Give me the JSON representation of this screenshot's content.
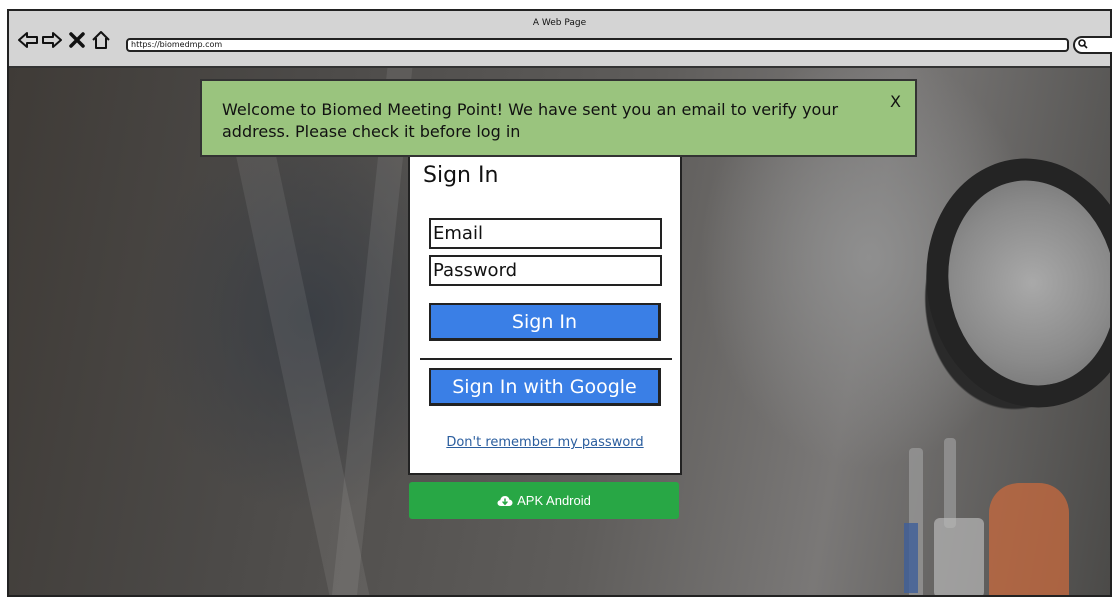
{
  "browser": {
    "page_title": "A Web Page",
    "url": "https://biomedmp.com",
    "nav": {
      "back_icon": "back-arrow-icon",
      "forward_icon": "forward-arrow-icon",
      "stop_icon": "close-icon",
      "home_icon": "home-icon",
      "search_icon": "search-icon"
    }
  },
  "notification": {
    "message": "Welcome to Biomed Meeting Point! We have sent you an email to verify your address. Please check it before log in",
    "close_label": "X",
    "color": "#9ac47e"
  },
  "signin": {
    "title": "Sign In",
    "email_placeholder": "Email",
    "password_placeholder": "Password",
    "submit_label": "Sign In",
    "google_label": "Sign In with Google",
    "forgot_label": "Don't remember my password",
    "button_color": "#3a7fe6"
  },
  "apk": {
    "label": "APK Android",
    "icon": "cloud-download-icon",
    "color": "#28a745"
  }
}
